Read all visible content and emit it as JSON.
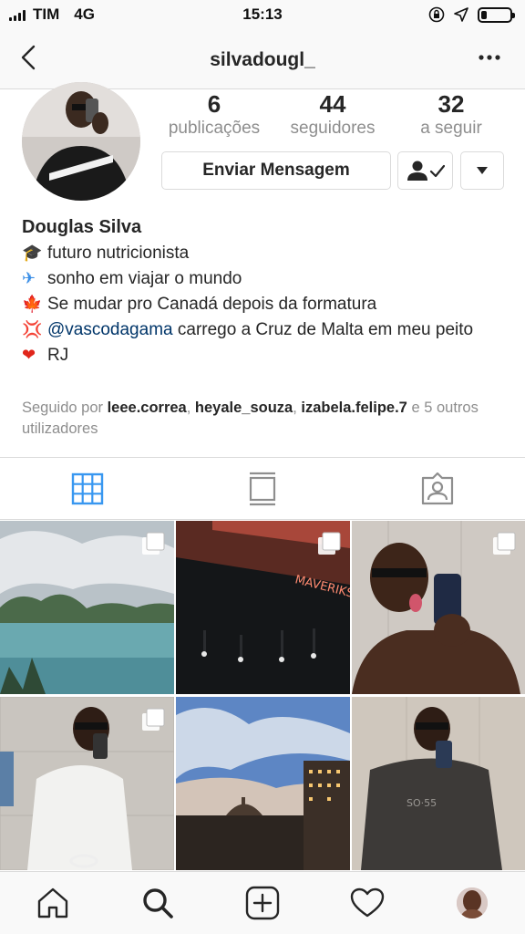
{
  "status_bar": {
    "carrier": "TIM",
    "network": "4G",
    "time": "15:13",
    "battery_level": 0.2
  },
  "nav": {
    "title": "silvadougl_",
    "back_icon": "chevron-left-icon",
    "more_icon": "more-horizontal-icon"
  },
  "profile": {
    "stats": [
      {
        "count": "6",
        "label": "publicações"
      },
      {
        "count": "44",
        "label": "seguidores"
      },
      {
        "count": "32",
        "label": "a seguir"
      }
    ],
    "message_button": "Enviar Mensagem",
    "name": "Douglas Silva",
    "bio": [
      {
        "emoji": "🎓",
        "text": "futuro nutricionista"
      },
      {
        "emoji": "✈",
        "text": "sonho em viajar o mundo"
      },
      {
        "emoji": "🍁",
        "text": "Se mudar pro Canadá depois da formatura"
      },
      {
        "emoji": "💢",
        "mention": "@vascodagama",
        "text": " carrego a Cruz de Malta em meu peito"
      },
      {
        "emoji": "❤",
        "text": "RJ"
      }
    ],
    "followed_by": {
      "prefix": "Seguido por ",
      "users": [
        "leee.correa",
        "heyale_souza",
        "izabela.felipe.7"
      ],
      "sep": ", ",
      "suffix": " e 5 outros utilizadores"
    }
  },
  "tabs": [
    "grid-icon",
    "feed-icon",
    "tagged-icon"
  ],
  "bottom_bar": [
    "home-icon",
    "search-icon",
    "add-post-icon",
    "heart-icon",
    "profile-avatar"
  ],
  "colors": {
    "accent": "#3897f0",
    "mention": "#003569",
    "muted": "#8e8e8e",
    "text": "#262626"
  }
}
